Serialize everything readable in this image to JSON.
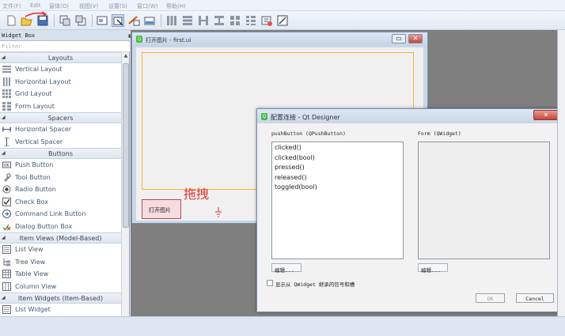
{
  "menubar": [
    "文件(F)",
    "Edit",
    "窗体(O)",
    "视图(V)",
    "设置(S)",
    "窗口(W)",
    "帮助(H)"
  ],
  "widget_box": {
    "title": "Widget Box",
    "filter_placeholder": "Filter",
    "categories": [
      {
        "label": "Layouts",
        "items": [
          "Vertical Layout",
          "Horizontal Layout",
          "Grid Layout",
          "Form Layout"
        ]
      },
      {
        "label": "Spacers",
        "items": [
          "Horizontal Spacer",
          "Vertical Spacer"
        ]
      },
      {
        "label": "Buttons",
        "items": [
          "Push Button",
          "Tool Button",
          "Radio Button",
          "Check Box",
          "Command Link Button",
          "Dialog Button Box"
        ]
      },
      {
        "label": "Item Views (Model-Based)",
        "items": [
          "List View",
          "Tree View",
          "Table View",
          "Column View"
        ]
      },
      {
        "label": "Item Widgets (Item-Based)",
        "items": [
          "List Widget"
        ]
      }
    ]
  },
  "form_window": {
    "title": "打开图片 - first.ui",
    "push_button_label": "打开图片",
    "drag_label": "拖拽"
  },
  "dialog": {
    "title": "配置连接 - Qt Designer",
    "left_header": "pushButton (QPushButton)",
    "right_header": "Form (QWidget)",
    "signals": [
      "clicked()",
      "clicked(bool)",
      "pressed()",
      "released()",
      "toggled(bool)"
    ],
    "edit_left": "编辑...",
    "edit_right": "编辑...",
    "checkbox_label": "显示从 QWidget 继承的信号和槽",
    "ok_label": "OK",
    "cancel_label": "Cancel"
  }
}
